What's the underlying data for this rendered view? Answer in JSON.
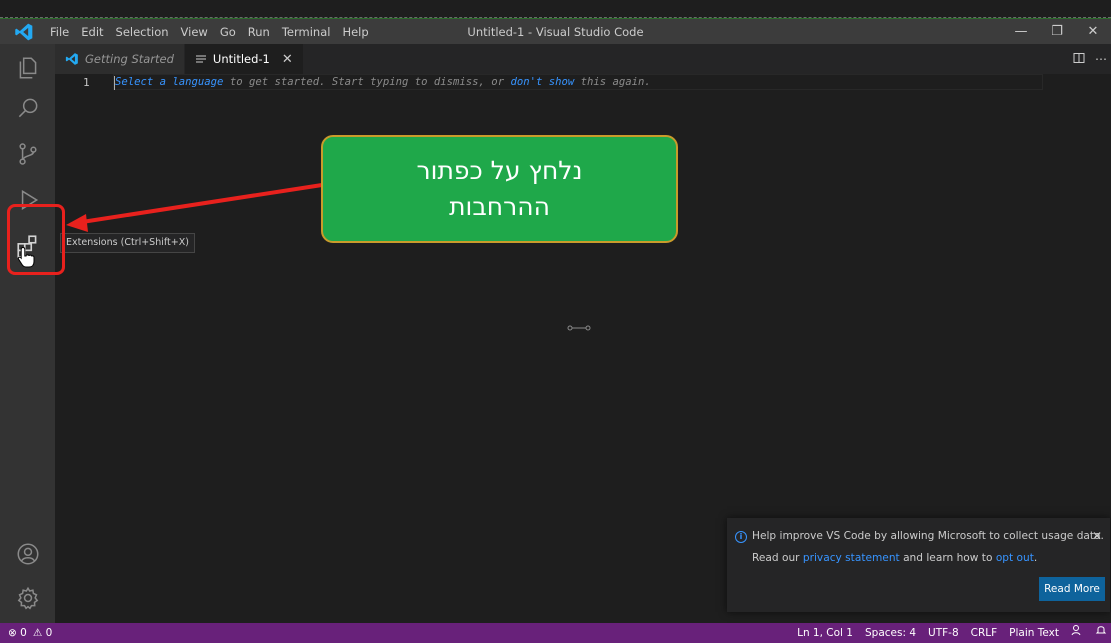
{
  "window": {
    "title": "Untitled-1 - Visual Studio Code",
    "menu": [
      "File",
      "Edit",
      "Selection",
      "View",
      "Go",
      "Run",
      "Terminal",
      "Help"
    ],
    "controls": {
      "minimize": "—",
      "restore": "❐",
      "close": "✕"
    }
  },
  "tabs": [
    {
      "label": "Getting Started",
      "icon": "vscode-logo-icon",
      "active": false
    },
    {
      "label": "Untitled-1",
      "icon": "file-lines-icon",
      "active": true,
      "close": "✕"
    }
  ],
  "editor": {
    "line_number": "1",
    "hint_parts": {
      "a": "Select a language",
      "b": " to get started. Start typing to dismiss, or ",
      "c": "don't show",
      "d": " this again."
    }
  },
  "activity": {
    "tooltip": "Extensions (Ctrl+Shift+X)"
  },
  "annotation": {
    "line1": "נלחץ על כפתור",
    "line2": "ההרחבות",
    "colors": {
      "callout": "#1fa84a",
      "border": "#c99b2b",
      "highlight": "#e8211d"
    }
  },
  "notification": {
    "line1": "Help improve VS Code by allowing Microsoft to collect usage data.",
    "line2_a": "Read our ",
    "line2_link1": "privacy statement",
    "line2_b": " and learn how to ",
    "line2_link2": "opt out",
    "line2_c": ".",
    "button": "Read More",
    "close": "✕"
  },
  "status": {
    "errors": "⊗ 0",
    "warnings": "⚠ 0",
    "position": "Ln 1, Col 1",
    "spaces": "Spaces: 4",
    "encoding": "UTF-8",
    "eol": "CRLF",
    "language": "Plain Text",
    "accent": "#68217a"
  }
}
